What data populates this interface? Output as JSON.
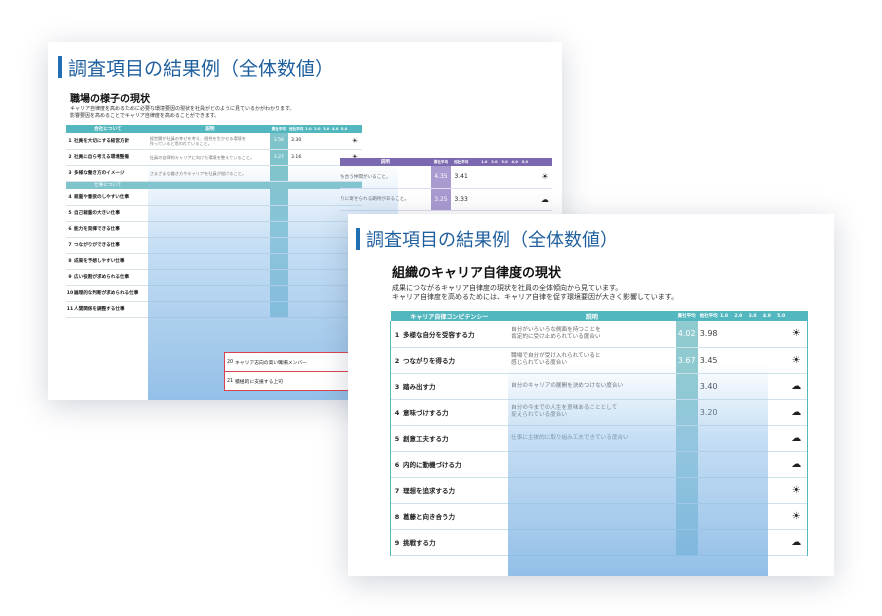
{
  "back": {
    "title": "調査項目の結果例（全体数値）",
    "subtitle": "職場の様子の現状",
    "desc_lines": [
      "キャリア自律度を高めるために必要な環境要因の現状を社員がどのように見ているかがわかります。",
      "影響要因を高めることでキャリア自律度を高めることができます。"
    ],
    "header": {
      "col1": "会社について",
      "col2": "説明",
      "score1": "貴社平均",
      "score2": "他社平均",
      "scale": [
        "1.0",
        "2.0",
        "3.0",
        "4.0",
        "5.0"
      ]
    },
    "section2_label": "仕事について",
    "rows": [
      {
        "no": "1",
        "label": "社員を大切にする経営方針",
        "desc1": "経営層が社員の幸せを考え、個性を生かせる環境を",
        "desc2": "作っていると思われていること。",
        "s1": "3.56",
        "s2": "3.30",
        "icon": "☀"
      },
      {
        "no": "2",
        "label": "社員に自ら考える環境整備",
        "desc1": "社員の自律的キャリアに向けた環境を整えていること。",
        "desc2": "",
        "s1": "3.27",
        "s2": "3.16",
        "icon": "☀"
      },
      {
        "no": "3",
        "label": "多様な働き方のイメージ",
        "desc1": "さまざまな働き方やキャリアを社員が描けること。",
        "desc2": "",
        "s1": "",
        "s2": "",
        "icon": ""
      },
      {
        "no": "4",
        "label": "裁量や意欲のしやすい仕事",
        "desc1": "",
        "desc2": "",
        "s1": "",
        "s2": "",
        "icon": ""
      },
      {
        "no": "5",
        "label": "自己裁量の大きい仕事",
        "desc1": "",
        "desc2": "",
        "s1": "",
        "s2": "",
        "icon": ""
      },
      {
        "no": "6",
        "label": "能力を発揮できる仕事",
        "desc1": "",
        "desc2": "",
        "s1": "",
        "s2": "",
        "icon": ""
      },
      {
        "no": "7",
        "label": "つながりができる仕事",
        "desc1": "",
        "desc2": "",
        "s1": "",
        "s2": "",
        "icon": ""
      },
      {
        "no": "8",
        "label": "成果を予想しやすい仕事",
        "desc1": "",
        "desc2": "",
        "s1": "",
        "s2": "",
        "icon": ""
      },
      {
        "no": "9",
        "label": "広い役割が求められる仕事",
        "desc1": "",
        "desc2": "",
        "s1": "",
        "s2": "",
        "icon": ""
      },
      {
        "no": "10",
        "label": "論理的な判断が求められる仕事",
        "desc1": "",
        "desc2": "",
        "s1": "",
        "s2": "",
        "icon": ""
      },
      {
        "no": "11",
        "label": "人間関係を調整する仕事",
        "desc1": "",
        "desc2": "",
        "s1": "",
        "s2": "",
        "icon": ""
      }
    ],
    "right_table": {
      "header": {
        "col": "説明",
        "score1": "貴社平均",
        "score2": "他社平均",
        "scale": [
          "1.0",
          "2.0",
          "3.0",
          "4.0",
          "5.0"
        ]
      },
      "rows": [
        {
          "desc": "ち合う仲間がいること。",
          "s1": "4.35",
          "s2": "3.41",
          "icon": "☀",
          "ratio": 0.85
        },
        {
          "desc": "りに寄せられる期待があること。",
          "s1": "3.25",
          "s2": "3.33",
          "icon": "☁",
          "ratio": 0.6
        }
      ]
    },
    "bottom_rows": [
      {
        "no": "20",
        "label": "キャリア志向の高い職場メンバー"
      },
      {
        "no": "21",
        "label": "積極的に支援する上司"
      }
    ]
  },
  "front": {
    "title": "調査項目の結果例（全体数値）",
    "subtitle": "組織のキャリア自律度の現状",
    "desc_lines": [
      "成果につながるキャリア自律度の現状を社員の全体傾向から見ています。",
      "キャリア自律度を高めるためには、キャリア自律を促す環境要因が大きく影響しています。"
    ],
    "header": {
      "col1": "キャリア自律コンピテンシー",
      "col2": "説明",
      "score1": "貴社平均",
      "score2": "他社平均",
      "scale": [
        "1.0",
        "2.0",
        "3.0",
        "4.0",
        "5.0"
      ]
    },
    "rows": [
      {
        "no": "1",
        "label": "多様な自分を受容する力",
        "desc1": "自分がいろいろな側面を持つことを",
        "desc2": "肯定的に受け止められている度合い",
        "s1": "4.02",
        "s2": "3.98",
        "icon": "☀",
        "ratio": 0.8
      },
      {
        "no": "2",
        "label": "つながりを得る力",
        "desc1": "職場で自分が受け入れられていると",
        "desc2": "感じられている度合い",
        "s1": "3.67",
        "s2": "3.45",
        "icon": "☀",
        "ratio": 0.72
      },
      {
        "no": "3",
        "label": "踏み出す力",
        "desc1": "自分のキャリアの展開を決めつけない度合い",
        "desc2": "",
        "s1": "",
        "s2": "3.40",
        "icon": "☁",
        "ratio": 0.6
      },
      {
        "no": "4",
        "label": "意味づけする力",
        "desc1": "自分の今までの人生を意味あることとして",
        "desc2": "捉えられている度合い",
        "s1": "",
        "s2": "3.20",
        "icon": "☁",
        "ratio": 0.56
      },
      {
        "no": "5",
        "label": "創意工夫する力",
        "desc1": "仕事に主体的に取り組み工夫できている度合い",
        "desc2": "",
        "s1": "",
        "s2": "",
        "icon": "☁",
        "ratio": 0.5
      },
      {
        "no": "6",
        "label": "内的に動機づける力",
        "desc1": "",
        "desc2": "",
        "s1": "",
        "s2": "",
        "icon": "☁",
        "ratio": 0.5
      },
      {
        "no": "7",
        "label": "理想を追求する力",
        "desc1": "",
        "desc2": "",
        "s1": "",
        "s2": "",
        "icon": "☀",
        "ratio": 0.5
      },
      {
        "no": "8",
        "label": "葛藤と向き合う力",
        "desc1": "",
        "desc2": "",
        "s1": "",
        "s2": "",
        "icon": "☀",
        "ratio": 0.5
      },
      {
        "no": "9",
        "label": "挑戦する力",
        "desc1": "",
        "desc2": "",
        "s1": "",
        "s2": "",
        "icon": "☁",
        "ratio": 0.5
      }
    ]
  },
  "colors": {
    "teal": "#53b7bf",
    "purple": "#7b68b0",
    "title_blue": "#1f5f9e",
    "accent_bar": "#1f6fb2",
    "red_line": "#d9434f"
  }
}
